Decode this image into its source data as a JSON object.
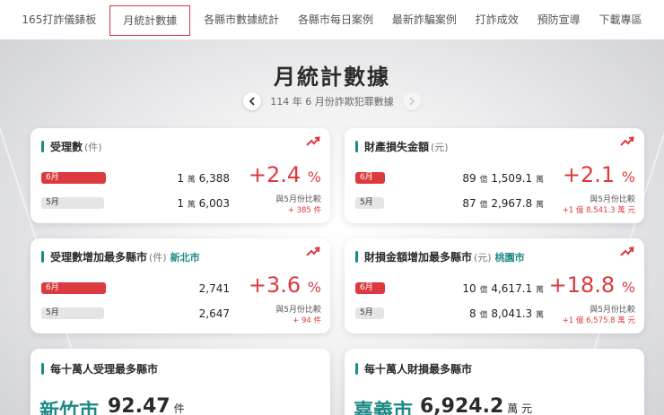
{
  "nav": {
    "items": [
      "165打詐儀錶板",
      "月統計數據",
      "各縣市數據統計",
      "各縣市每日案例",
      "最新詐騙案例",
      "打詐成效",
      "預防宣導",
      "下載專區"
    ],
    "active_index": 1
  },
  "page": {
    "title": "月統計數據",
    "month_label": "114 年 6 月份詐欺犯罪數據"
  },
  "colors": {
    "accent": "#dc3a3f",
    "teal": "#1e8a86"
  },
  "icons": {
    "trend": "trending-up-icon",
    "prev": "chevron-left-icon",
    "next": "chevron-right-icon"
  },
  "cards": {
    "cases": {
      "title": "受理數",
      "unit": "(件)",
      "cur_label": "6月",
      "prev_label": "5月",
      "cur_value": "1",
      "cur_value_wan": "萬",
      "cur_value_rest": "6,388",
      "prev_value": "1",
      "prev_value_wan": "萬",
      "prev_value_rest": "6,003",
      "cur_ratio": 0.55,
      "prev_ratio": 0.53,
      "pct": "+2.4",
      "pct_sign": "%",
      "compare": "與5月份比較",
      "diff": "+ 385 件"
    },
    "loss": {
      "title": "財產損失金額",
      "unit": "(元)",
      "cur_label": "6月",
      "prev_label": "5月",
      "cur_value": "89",
      "cur_value_yi": "億",
      "cur_value_rest": "1,509.1",
      "cur_value_wan": "萬",
      "prev_value": "87",
      "prev_value_yi": "億",
      "prev_value_rest": "2,967.8",
      "prev_value_wan": "萬",
      "cur_ratio": 0.3,
      "prev_ratio": 0.29,
      "pct": "+2.1",
      "pct_sign": "%",
      "compare": "與5月份比較",
      "diff": "+1 億 8,541.3 萬 元"
    },
    "cases_city": {
      "title": "受理數增加最多縣市",
      "unit": "(件)",
      "city": "新北市",
      "cur_label": "6月",
      "prev_label": "5月",
      "cur_value": "2,741",
      "prev_value": "2,647",
      "cur_ratio": 0.55,
      "prev_ratio": 0.53,
      "pct": "+3.6",
      "pct_sign": "%",
      "compare": "與5月份比較",
      "diff": "+ 94 件"
    },
    "loss_city": {
      "title": "財損金額增加最多縣市",
      "unit": "(元)",
      "city": "桃園市",
      "cur_label": "6月",
      "prev_label": "5月",
      "cur_value": "10",
      "cur_value_yi": "億",
      "cur_value_rest": "4,617.1",
      "cur_value_wan": "萬",
      "prev_value": "8",
      "prev_value_yi": "億",
      "prev_value_rest": "8,041.3",
      "prev_value_wan": "萬",
      "cur_ratio": 0.3,
      "prev_ratio": 0.29,
      "pct": "+18.8",
      "pct_sign": "%",
      "compare": "與5月份比較",
      "diff": "+1 億 6,575.8 萬 元"
    },
    "per_capita_cases": {
      "title": "每十萬人受理最多縣市",
      "city": "新竹市",
      "value": "92.47",
      "unit": "件"
    },
    "per_capita_loss": {
      "title": "每十萬人財損最多縣市",
      "city": "嘉義市",
      "value": "6,924.2",
      "unit": "萬 元"
    }
  }
}
